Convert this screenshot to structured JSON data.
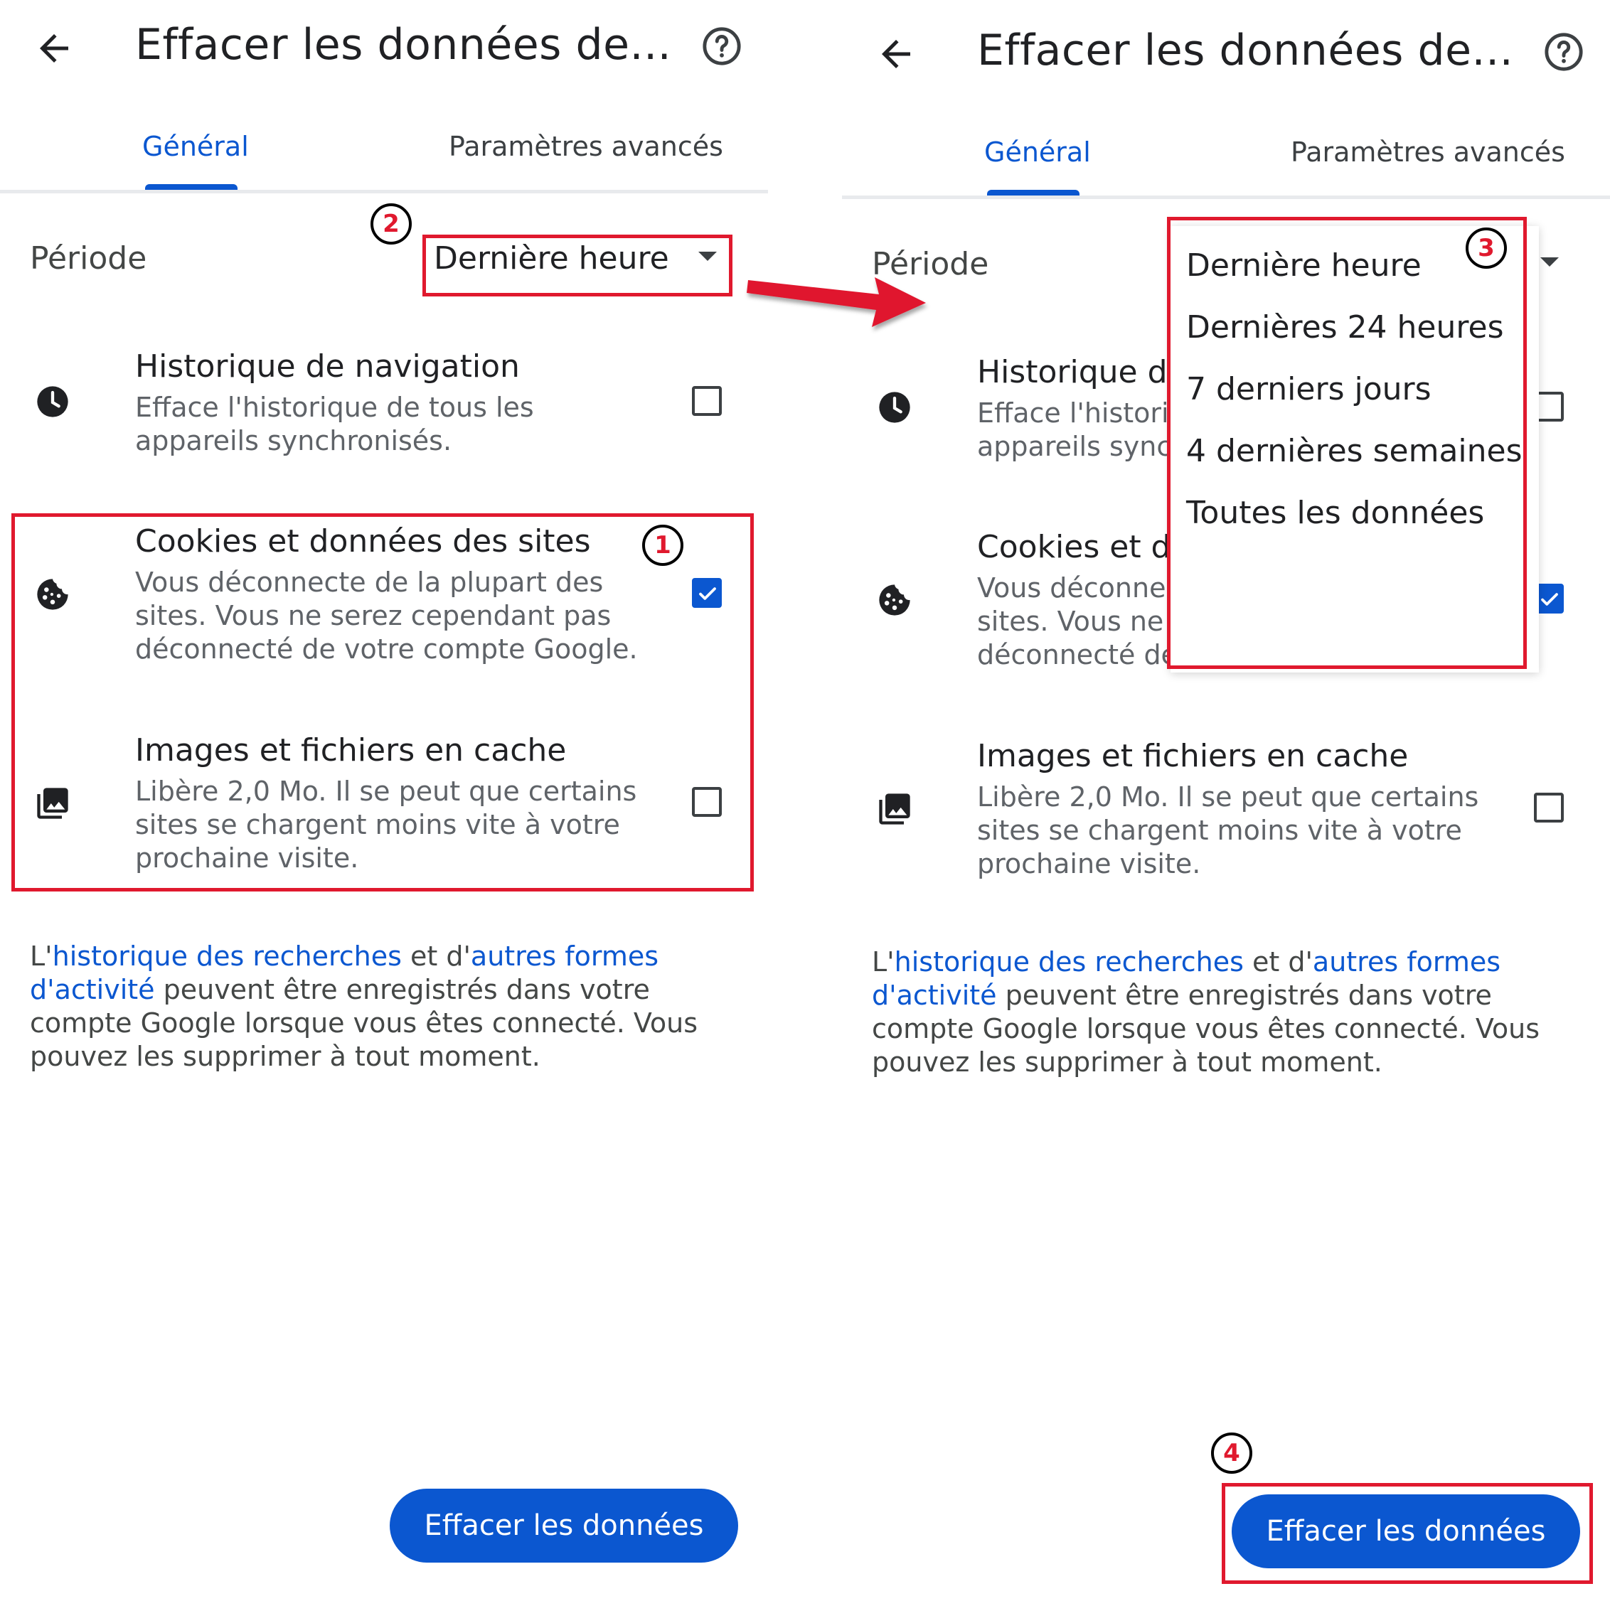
{
  "app": {
    "title": "Effacer les données de...",
    "tabs": {
      "general": "Général",
      "advanced": "Paramètres avancés"
    },
    "period": {
      "label": "Période",
      "value": "Dernière heure"
    },
    "items": [
      {
        "title": "Historique de navigation",
        "desc": "Efface l'historique de tous les appareils synchronisés.",
        "checked": false,
        "icon": "clock-icon"
      },
      {
        "title": "Cookies et données des sites",
        "desc": "Vous déconnecte de la plupart des sites. Vous ne serez cependant pas déconnecté de votre compte Google.",
        "checked": true,
        "icon": "cookie-icon"
      },
      {
        "title": "Images et fichiers en cache",
        "desc": "Libère 2,0 Mo. Il se peut que certains sites se chargent moins vite à votre prochaine visite.",
        "checked": false,
        "icon": "image-icon"
      }
    ],
    "footer": {
      "pre": "L'",
      "link1": "historique des recherches",
      "mid": " et d'",
      "link2": "autres formes d'activité",
      "post": " peuvent être enregistrés dans votre compte Google lorsque vous êtes connecté. Vous pouvez les supprimer à tout moment."
    },
    "clear_button": "Effacer les données",
    "period_options": [
      "Dernière heure",
      "Dernières 24 heures",
      "7 derniers jours",
      "4 dernières semaines",
      "Toutes les données"
    ]
  },
  "annotations": {
    "steps": [
      "1",
      "2",
      "3",
      "4"
    ],
    "color": "#e0192e"
  },
  "colors": {
    "accent": "#0b57d0",
    "text": "#202124",
    "secondary": "#5f6368"
  }
}
